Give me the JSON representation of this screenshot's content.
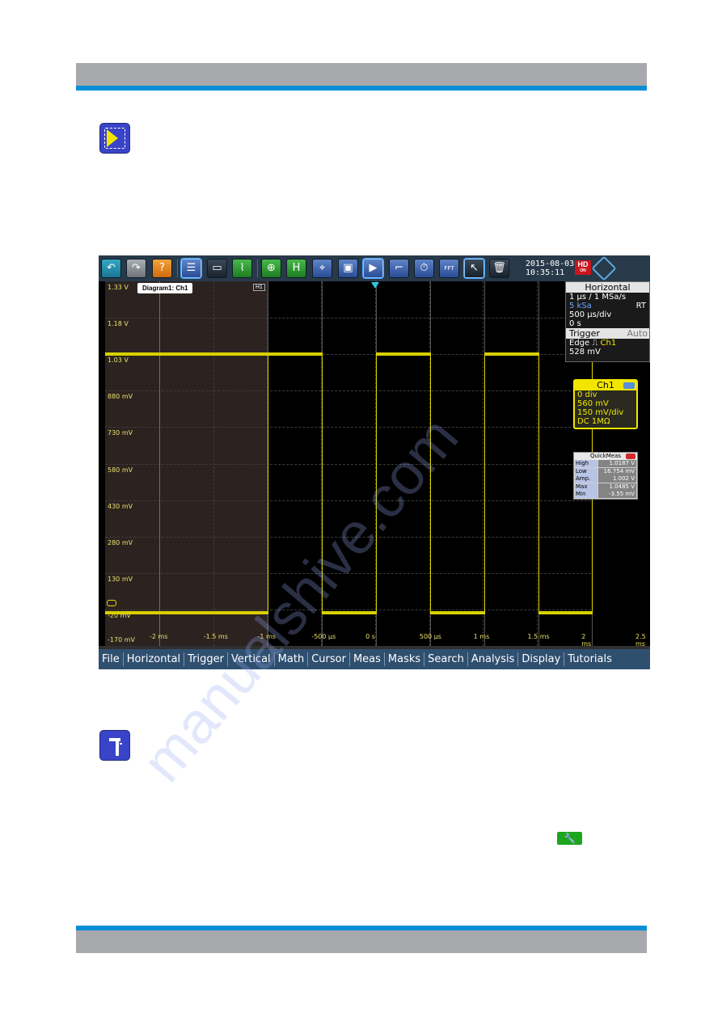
{
  "page": {
    "header_color": "#a7a9ac",
    "accent_color": "#0a8fd6"
  },
  "scope": {
    "toolbar": {
      "buttons": [
        {
          "name": "undo",
          "glyph": "↶",
          "style": "teal"
        },
        {
          "name": "redo",
          "glyph": "↷",
          "style": "gray"
        },
        {
          "name": "help",
          "glyph": "?",
          "style": "orange"
        },
        {
          "name": "signal-bar",
          "glyph": "☰",
          "style": "blue"
        },
        {
          "name": "save-recall",
          "glyph": "▭",
          "style": "dark"
        },
        {
          "name": "autoset",
          "glyph": "⌇",
          "style": "green"
        },
        {
          "name": "zoom",
          "glyph": "⊕",
          "style": "green"
        },
        {
          "name": "history",
          "glyph": "H",
          "style": "green"
        },
        {
          "name": "cursor",
          "glyph": "⌖",
          "style": "blue"
        },
        {
          "name": "mask",
          "glyph": "▣",
          "style": "blue"
        },
        {
          "name": "search",
          "glyph": "▶",
          "style": "blue"
        },
        {
          "name": "measure",
          "glyph": "⌐",
          "style": "blue"
        },
        {
          "name": "quickmeas",
          "glyph": "⏱",
          "style": "blue"
        },
        {
          "name": "fft",
          "glyph": "FFT",
          "style": "blue"
        },
        {
          "name": "select",
          "glyph": "↖",
          "style": "dark"
        },
        {
          "name": "delete",
          "glyph": "🗑",
          "style": "dark"
        }
      ],
      "date": "2015-08-03",
      "time": "10:35:11",
      "hd_badge": "HD",
      "hd_sub": "ON"
    },
    "diagram": {
      "label": "Diagram1: Ch1",
      "history_label": "H1",
      "y_ticks": [
        "1.33 V",
        "1.18 V",
        "1.03 V",
        "880 mV",
        "730 mV",
        "580 mV",
        "430 mV",
        "280 mV",
        "130 mV",
        "-20 mV",
        "-170 mV"
      ],
      "x_ticks": [
        "-2 ms",
        "-1.5 ms",
        "-1 ms",
        "-500 µs",
        "0 s",
        "500 µs",
        "1 ms",
        "1.5 ms",
        "2 ms",
        "2.5 ms"
      ],
      "signal_color": "#d8d000",
      "trigger_marker_color": "#2fc6e0"
    },
    "horizontal": {
      "title": "Horizontal",
      "resolution": "1 µs / 1 MSa/s",
      "record_length": "5 kSa",
      "mode": "RT",
      "scale": "500 µs/div",
      "position": "0 s"
    },
    "trigger": {
      "title": "Trigger",
      "mode": "Auto",
      "type": "Edge",
      "slope_icon": "⎍",
      "source": "Ch1",
      "level": "528 mV"
    },
    "channel": {
      "title": "Ch1",
      "offset_div": "0 div",
      "offset": "560 mV",
      "scale": "150 mV/div",
      "coupling": "DC 1MΩ"
    },
    "quickmeas": {
      "title": "QuickMeas",
      "rows": [
        {
          "label": "High",
          "value": "1.0187 V"
        },
        {
          "label": "Low",
          "value": "16.754 mV"
        },
        {
          "label": "Amp.",
          "value": "1.002 V"
        },
        {
          "label": "Max",
          "value": "1.0485 V"
        },
        {
          "label": "Min",
          "value": "-3.55 mV"
        }
      ]
    },
    "menu": [
      "File",
      "Horizontal",
      "Trigger",
      "Vertical",
      "Math",
      "Cursor",
      "Meas",
      "Masks",
      "Search",
      "Analysis",
      "Display",
      "Tutorials"
    ]
  },
  "icons": {
    "run_single_icon": "play-triangle",
    "measure_icon": "caliper",
    "wrench_glyph": "🔧"
  },
  "watermark": "manualshive.com"
}
